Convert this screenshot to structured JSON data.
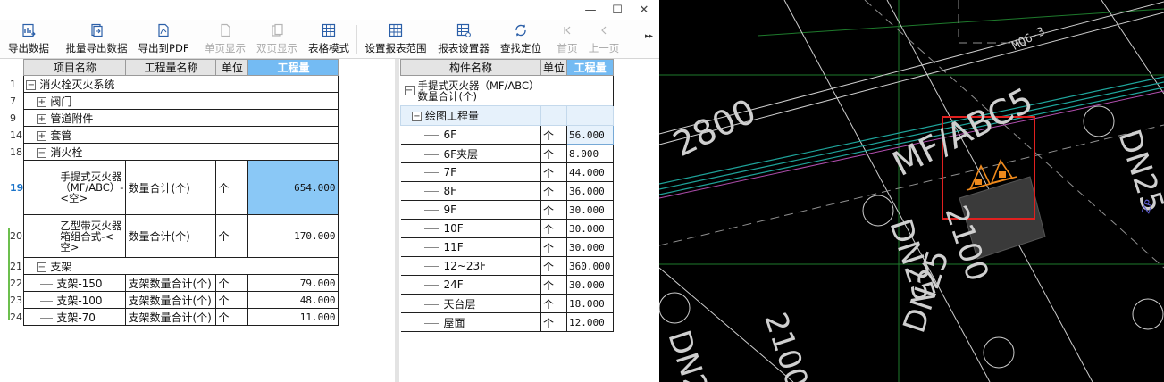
{
  "window": {
    "controls": {
      "minimize": "—",
      "maximize": "☐",
      "close": "✕"
    }
  },
  "toolbar": {
    "buttons": [
      {
        "label": "导出数据",
        "icon": "export-data-icon",
        "enabled": true
      },
      {
        "label": "批量导出数据",
        "icon": "batch-export-icon",
        "enabled": true
      },
      {
        "label": "导出到PDF",
        "icon": "export-pdf-icon",
        "enabled": true
      },
      {
        "label": "单页显示",
        "icon": "single-page-icon",
        "enabled": false
      },
      {
        "label": "双页显示",
        "icon": "double-page-icon",
        "enabled": false
      },
      {
        "label": "表格模式",
        "icon": "table-mode-icon",
        "enabled": true
      },
      {
        "label": "设置报表范围",
        "icon": "report-range-icon",
        "enabled": true
      },
      {
        "label": "报表设置器",
        "icon": "report-settings-icon",
        "enabled": true
      },
      {
        "label": "查找定位",
        "icon": "find-locate-icon",
        "enabled": true
      },
      {
        "label": "首页",
        "icon": "first-page-icon",
        "enabled": false
      },
      {
        "label": "上一页",
        "icon": "prev-page-icon",
        "enabled": false
      }
    ],
    "overflow": "▸▸"
  },
  "left_table": {
    "headers": [
      "项目名称",
      "工程量名称",
      "单位",
      "工程量"
    ],
    "rows": [
      {
        "num": "1",
        "name": "消火栓灭火系统",
        "expander": "−",
        "level": 0
      },
      {
        "num": "7",
        "name": "阀门",
        "expander": "+",
        "level": 1
      },
      {
        "num": "9",
        "name": "管道附件",
        "expander": "+",
        "level": 1
      },
      {
        "num": "14",
        "name": "套管",
        "expander": "+",
        "level": 1
      },
      {
        "num": "18",
        "name": "消火栓",
        "expander": "−",
        "level": 1
      },
      {
        "num": "19",
        "name": "手提式灭火器（MF/ABC）-<空>",
        "qty_name": "数量合计(个)",
        "unit": "个",
        "value": "654.000",
        "level": 2,
        "selected": true
      },
      {
        "num": "20",
        "name": "乙型带灭火器箱组合式-<空>",
        "qty_name": "数量合计(个)",
        "unit": "个",
        "value": "170.000",
        "level": 2
      },
      {
        "num": "21",
        "name": "支架",
        "expander": "−",
        "level": 1
      },
      {
        "num": "22",
        "name": "支架-150",
        "qty_name": "支架数量合计(个)",
        "unit": "个",
        "value": "79.000",
        "level": 2
      },
      {
        "num": "23",
        "name": "支架-100",
        "qty_name": "支架数量合计(个)",
        "unit": "个",
        "value": "48.000",
        "level": 2
      },
      {
        "num": "24",
        "name": "支架-70",
        "qty_name": "支架数量合计(个)",
        "unit": "个",
        "value": "11.000",
        "level": 2
      }
    ]
  },
  "right_table": {
    "headers": [
      "构件名称",
      "单位",
      "工程量"
    ],
    "title_line1": "手提式灭火器（MF/ABC）",
    "title_line2": "数量合计(个)",
    "group_label": "绘图工程量",
    "rows": [
      {
        "name": "6F",
        "unit": "个",
        "value": "56.000",
        "selected": true
      },
      {
        "name": "6F夹层",
        "unit": "个",
        "value": "8.000"
      },
      {
        "name": "7F",
        "unit": "个",
        "value": "44.000"
      },
      {
        "name": "8F",
        "unit": "个",
        "value": "36.000"
      },
      {
        "name": "9F",
        "unit": "个",
        "value": "30.000"
      },
      {
        "name": "10F",
        "unit": "个",
        "value": "30.000"
      },
      {
        "name": "11F",
        "unit": "个",
        "value": "30.000"
      },
      {
        "name": "12~23F",
        "unit": "个",
        "value": "360.000"
      },
      {
        "name": "24F",
        "unit": "个",
        "value": "30.000"
      },
      {
        "name": "天台层",
        "unit": "个",
        "value": "18.000"
      },
      {
        "name": "屋面",
        "unit": "个",
        "value": "12.000"
      }
    ]
  },
  "cad": {
    "labels": {
      "mq": "MQ6-3",
      "dim_2800": "2800",
      "mf_abc": "MF/ABC5",
      "dn25_a": "DN25",
      "dn25_b": "DN25",
      "dn25_c": "DN25",
      "dim_2100_a": "2100",
      "dim_2100_b": "2100",
      "dn_partial": "DN2",
      "zp": "ZP"
    },
    "colors": {
      "background": "#000000",
      "highlight_box": "#e0201f",
      "extinguisher": "#f08a1c",
      "pipe": "#1fa59c",
      "wall": "#cfcfcf",
      "grid_line": "#1e7a2c"
    }
  }
}
